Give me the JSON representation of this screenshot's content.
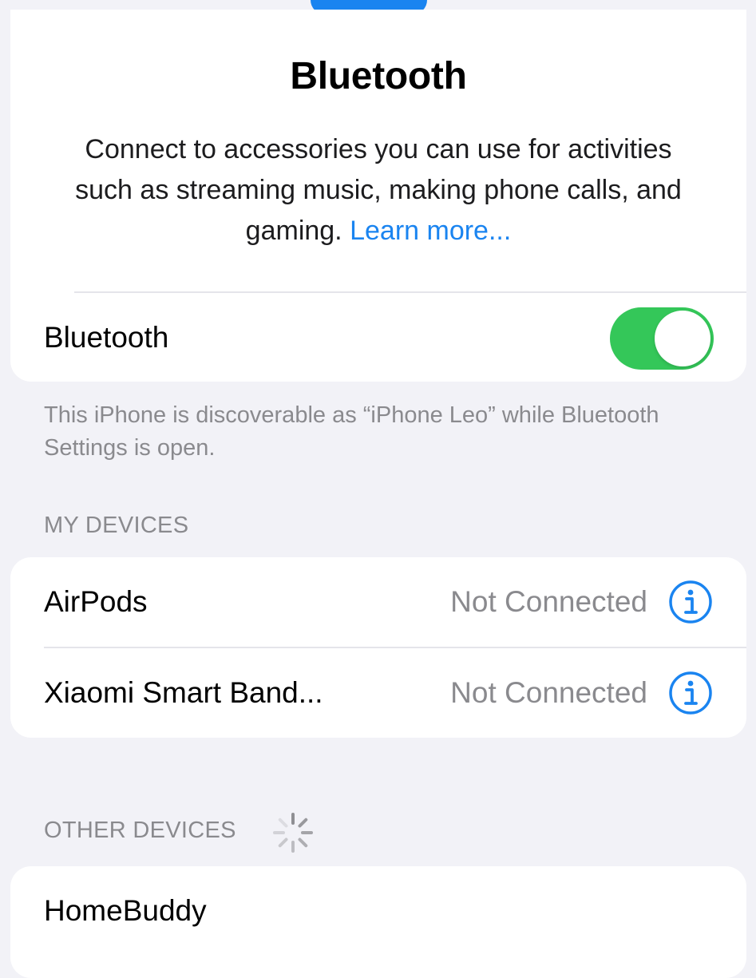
{
  "header": {
    "title": "Bluetooth",
    "description": "Connect to accessories you can use for activities such as streaming music, making phone calls, and gaming.",
    "learn_more": "Learn more..."
  },
  "bluetooth_toggle": {
    "label": "Bluetooth",
    "on": true,
    "on_color": "#34c759"
  },
  "discoverable_note": "This iPhone is discoverable as “iPhone Leo” while Bluetooth Settings is open.",
  "my_devices": {
    "header": "MY DEVICES",
    "items": [
      {
        "name": "AirPods",
        "status": "Not Connected",
        "icon": "info-icon"
      },
      {
        "name": "Xiaomi Smart Band...",
        "status": "Not Connected",
        "icon": "info-icon"
      }
    ]
  },
  "other_devices": {
    "header": "OTHER DEVICES",
    "loading_icon": "spinner-icon",
    "items": [
      {
        "name": "HomeBuddy"
      }
    ]
  },
  "colors": {
    "accent": "#1a84f0",
    "background": "#f2f2f7",
    "secondary_text": "#8a8a8e"
  }
}
